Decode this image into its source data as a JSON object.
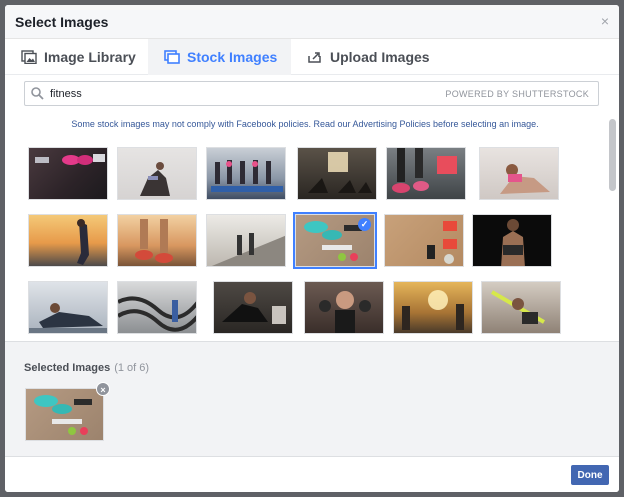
{
  "dialog": {
    "title": "Select Images",
    "close_glyph": "×"
  },
  "tabs": [
    {
      "label": "Image Library",
      "icon": "image-library-icon",
      "active": false
    },
    {
      "label": "Stock Images",
      "icon": "stock-images-icon",
      "active": true
    },
    {
      "label": "Upload Images",
      "icon": "upload-icon",
      "active": false
    }
  ],
  "search": {
    "value": "fitness",
    "placeholder": "",
    "powered_by": "POWERED BY SHUTTERSTOCK"
  },
  "notice": {
    "text": "Some stock images may not comply with Facebook policies. Read our Advertising Policies before selecting an image."
  },
  "thumbnails_description": "fitness stock photo grid",
  "selected": {
    "title": "Selected Images",
    "count_label": "(1 of 6)",
    "remove_glyph": "×"
  },
  "footer": {
    "done_label": "Done"
  },
  "colors": {
    "accent": "#4080ff",
    "primary_button": "#4267b2",
    "link": "#365899"
  }
}
